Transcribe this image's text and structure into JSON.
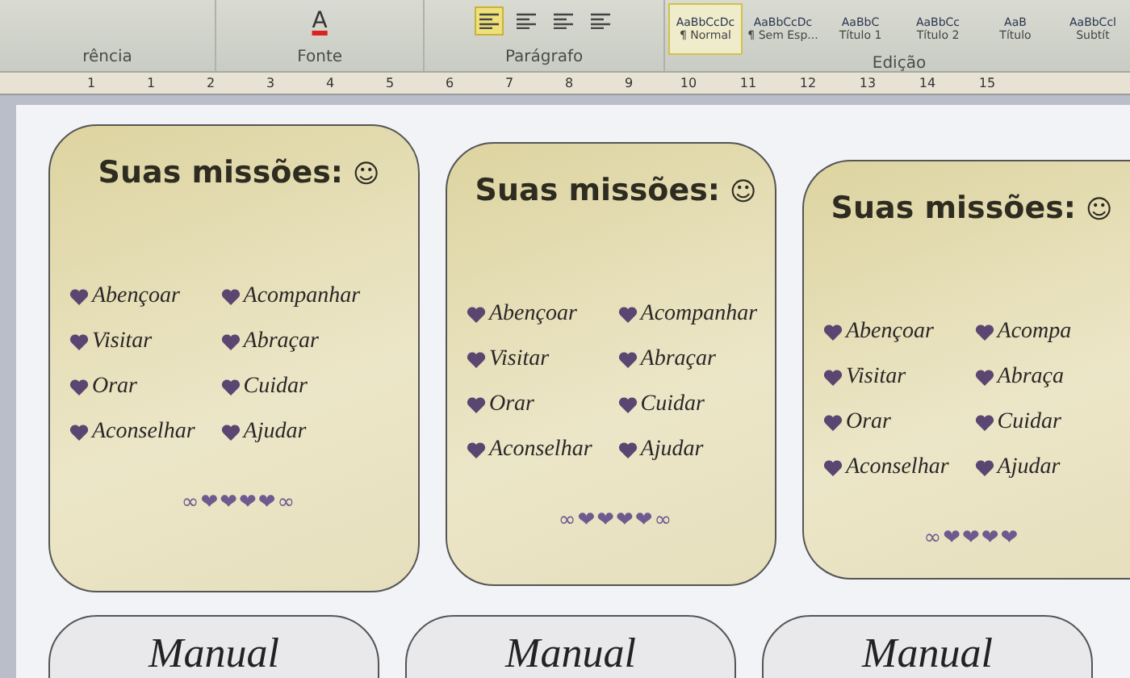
{
  "ribbon": {
    "left_fragment": "rência",
    "font_color_letter": "A",
    "groups": [
      {
        "label": "Fonte"
      },
      {
        "label": "Parágrafo"
      }
    ],
    "align_buttons": [
      {
        "selected": true
      },
      {
        "selected": false
      },
      {
        "selected": false
      },
      {
        "selected": false
      }
    ],
    "styles": [
      {
        "preview": "AaBbCcDc",
        "name": "¶ Normal",
        "selected": true
      },
      {
        "preview": "AaBbCcDc",
        "name": "¶ Sem Esp...",
        "selected": false
      },
      {
        "preview": "AaBbC",
        "name": "Título 1",
        "selected": false
      },
      {
        "preview": "AaBbCc",
        "name": "Título 2",
        "selected": false
      },
      {
        "preview": "AaB",
        "name": "Título",
        "selected": false
      },
      {
        "preview": "AaBbCcl",
        "name": "Subtít",
        "selected": false
      }
    ],
    "styles_group": "Edição"
  },
  "ruler": {
    "marks": [
      "1",
      "1",
      "2",
      "3",
      "4",
      "5",
      "6",
      "7",
      "8",
      "9",
      "10",
      "11",
      "12",
      "13",
      "14",
      "15"
    ]
  },
  "cards": [
    {
      "title": "Suas missões:",
      "smiley": "☺",
      "items": [
        "Abençoar",
        "Acompanhar",
        "Visitar",
        "Abraçar",
        "Orar",
        "Cuidar",
        "Aconselhar",
        "Ajudar"
      ],
      "ornament": "∞❤❤❤❤∞"
    },
    {
      "title": "Suas missões:",
      "smiley": "☺",
      "items": [
        "Abençoar",
        "Acompanhar",
        "Visitar",
        "Abraçar",
        "Orar",
        "Cuidar",
        "Aconselhar",
        "Ajudar"
      ],
      "ornament": "∞❤❤❤❤∞"
    },
    {
      "title": "Suas missões:",
      "smiley": "☺",
      "items": [
        "Abençoar",
        "Acompa",
        "Visitar",
        "Abraça",
        "Orar",
        "Cuidar",
        "Aconselhar",
        "Ajudar"
      ],
      "ornament": "∞❤❤❤❤"
    }
  ],
  "bottom_cards": [
    {
      "title": "Manual"
    },
    {
      "title": "Manual"
    },
    {
      "title": "Manual"
    }
  ]
}
